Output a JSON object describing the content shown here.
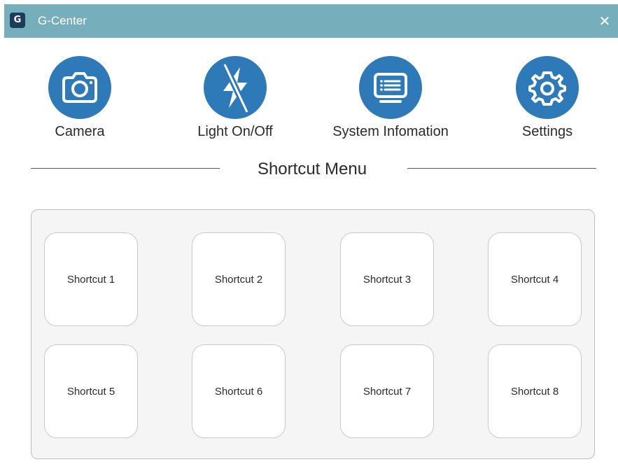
{
  "window": {
    "logo_letter": "G",
    "title": "G-Center",
    "close_symbol": "✕"
  },
  "features": [
    {
      "label": "Camera",
      "icon": "camera-icon"
    },
    {
      "label": "Light On/Off",
      "icon": "light-toggle-icon"
    },
    {
      "label": "System Infomation",
      "icon": "system-info-icon"
    },
    {
      "label": "Settings",
      "icon": "gear-icon"
    }
  ],
  "section": {
    "title": "Shortcut Menu"
  },
  "shortcuts": [
    {
      "label": "Shortcut 1"
    },
    {
      "label": "Shortcut 2"
    },
    {
      "label": "Shortcut 3"
    },
    {
      "label": "Shortcut 4"
    },
    {
      "label": "Shortcut 5"
    },
    {
      "label": "Shortcut 6"
    },
    {
      "label": "Shortcut 7"
    },
    {
      "label": "Shortcut 8"
    }
  ],
  "colors": {
    "titlebar": "#77aebb",
    "icon_circle": "#2e7ab8",
    "logo_bg": "#1c3c5c",
    "panel_bg": "#f5f5f5"
  }
}
